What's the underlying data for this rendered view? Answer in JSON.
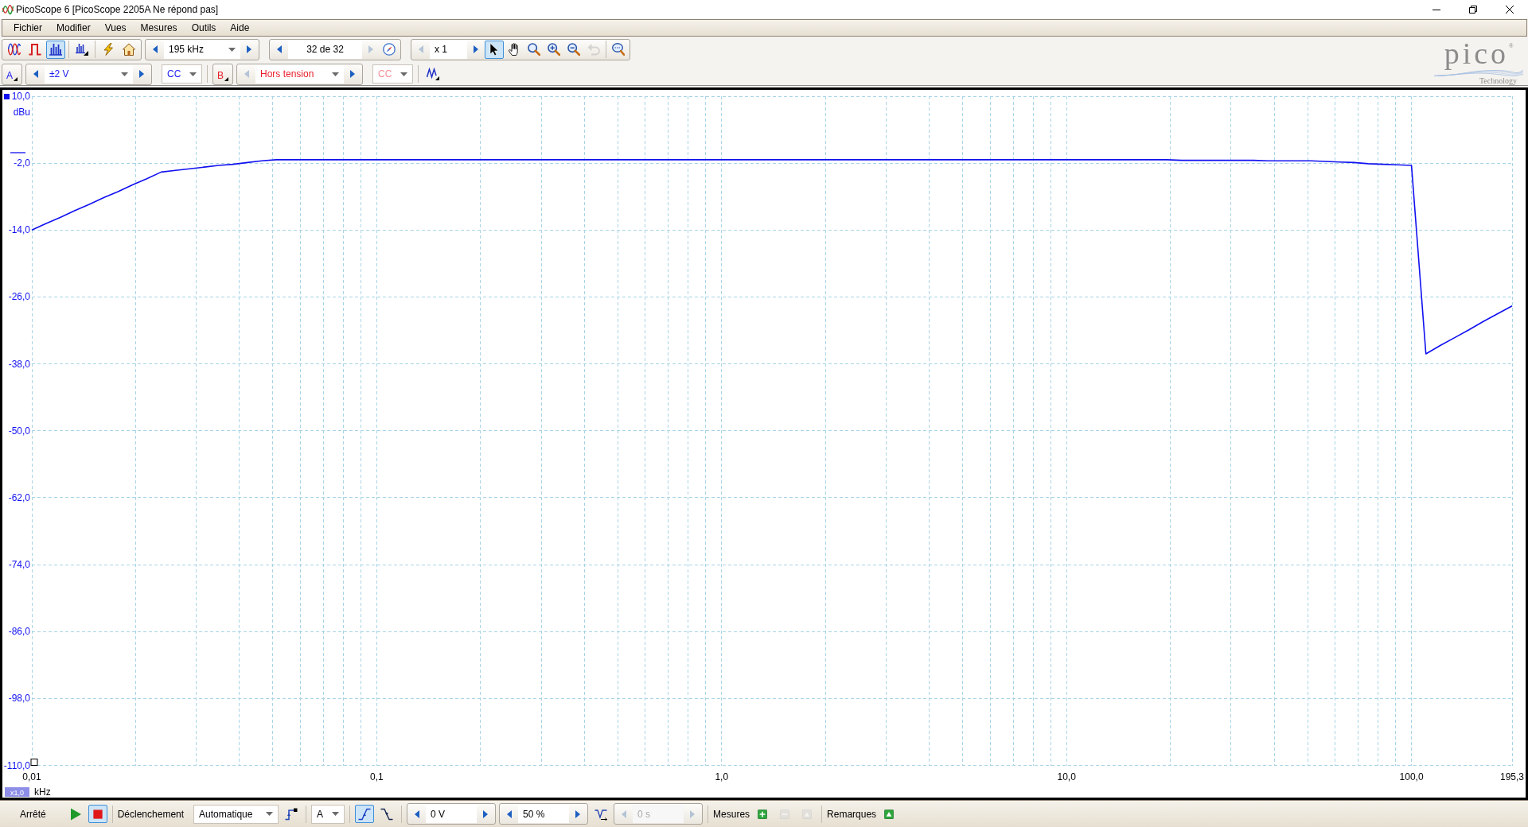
{
  "window": {
    "title": "PicoScope 6 [PicoScope 2205A Ne répond pas]"
  },
  "menu": [
    "Fichier",
    "Modifier",
    "Vues",
    "Mesures",
    "Outils",
    "Aide"
  ],
  "toolbar": {
    "modes": [
      {
        "kind": "scope",
        "selected": false
      },
      {
        "kind": "persistence",
        "selected": false
      },
      {
        "kind": "spectrum",
        "selected": true
      }
    ],
    "frequency_range": {
      "value": "195 kHz",
      "prev_disabled": false,
      "next_disabled": false
    },
    "buffer": {
      "value": "32 de 32",
      "prev_disabled": false,
      "next_disabled": true
    },
    "zoom_factor": {
      "value": "x 1",
      "prev_disabled": true,
      "next_disabled": false
    },
    "tools": [
      {
        "kind": "pointer",
        "selected": true,
        "disabled": false
      },
      {
        "kind": "hand",
        "selected": false,
        "disabled": false
      },
      {
        "kind": "zoom",
        "selected": false,
        "disabled": false
      },
      {
        "kind": "zoom_in",
        "selected": false,
        "disabled": false
      },
      {
        "kind": "zoom_out",
        "selected": false,
        "disabled": false
      },
      {
        "kind": "undo",
        "selected": false,
        "disabled": true
      }
    ]
  },
  "logo": {
    "name": "pico",
    "mark": "®",
    "tagline": "Technology"
  },
  "channels": [
    {
      "label": "A",
      "color": "#1c1cf0",
      "range": "±2 V",
      "prev_disabled": false,
      "next_disabled": false,
      "coupling": "CC",
      "coupling_disabled": false
    },
    {
      "label": "B",
      "color": "#e8202c",
      "range": "Hors tension",
      "prev_disabled": true,
      "next_disabled": false,
      "coupling": "CC",
      "coupling_disabled": true
    }
  ],
  "chart": {
    "x_zoom": "x1,0",
    "chart_data": {
      "type": "line",
      "grid": true,
      "xlabel": "kHz",
      "ylabel": "dBu",
      "categories": [
        "0,01",
        null,
        null,
        null,
        null,
        null,
        null,
        null,
        null,
        null,
        null,
        null,
        null,
        null,
        null,
        null,
        null,
        null,
        null,
        null,
        null,
        null,
        null,
        null,
        "0,1",
        null,
        null,
        null,
        null,
        null,
        null,
        null,
        null,
        null,
        null,
        null,
        null,
        null,
        null,
        null,
        null,
        null,
        null,
        null,
        null,
        null,
        null,
        null,
        "1,0",
        null,
        null,
        null,
        null,
        null,
        null,
        null,
        null,
        null,
        null,
        null,
        null,
        null,
        null,
        null,
        null,
        null,
        null,
        null,
        null,
        null,
        null,
        null,
        "10,0",
        null,
        null,
        null,
        null,
        null,
        null,
        null,
        null,
        null,
        null,
        null,
        null,
        null,
        null,
        null,
        null,
        null,
        null,
        null,
        null,
        null,
        null,
        null,
        "100,0",
        null,
        null,
        null,
        null,
        null,
        null,
        "195,3"
      ],
      "series": [
        {
          "color": "#1010f0",
          "values": [
            -14,
            -12.8,
            -11.7,
            -10.5,
            -9.4,
            -8.2,
            -7.1,
            -5.9,
            -4.8,
            -3.6,
            -3.3,
            -3,
            -2.7,
            -2.4,
            -2.2,
            -1.9,
            -1.6,
            -1.4,
            -1.4,
            -1.4,
            -1.4,
            -1.4,
            -1.4,
            -1.4,
            -1.4,
            -1.4,
            -1.4,
            -1.4,
            -1.4,
            -1.4,
            -1.4,
            -1.4,
            -1.4,
            -1.4,
            -1.4,
            -1.4,
            -1.4,
            -1.4,
            -1.4,
            -1.4,
            -1.4,
            -1.4,
            -1.4,
            -1.4,
            -1.4,
            -1.4,
            -1.4,
            -1.4,
            -1.4,
            -1.4,
            -1.4,
            -1.4,
            -1.4,
            -1.4,
            -1.4,
            -1.4,
            -1.4,
            -1.4,
            -1.4,
            -1.4,
            -1.4,
            -1.4,
            -1.4,
            -1.4,
            -1.4,
            -1.4,
            -1.4,
            -1.4,
            -1.4,
            -1.4,
            -1.4,
            -1.4,
            -1.4,
            -1.4,
            -1.4,
            -1.4,
            -1.4,
            -1.4,
            -1.4,
            -1.4,
            -1.5,
            -1.5,
            -1.5,
            -1.5,
            -1.5,
            -1.5,
            -1.6,
            -1.6,
            -1.6,
            -1.6,
            -1.7,
            -1.8,
            -1.9,
            -2.1,
            -2.2,
            -2.3,
            -2.4,
            -36.2,
            -34.7,
            -33.3,
            -31.9,
            -30.4,
            -29,
            -27.6
          ]
        }
      ],
      "ylim": [
        -110,
        10
      ],
      "yticks": [
        {
          "value": 10,
          "label": "10,0"
        },
        {
          "value": -2,
          "label": "-2,0"
        },
        {
          "value": -14,
          "label": "-14,0"
        },
        {
          "value": -26,
          "label": "-26,0"
        },
        {
          "value": -38,
          "label": "-38,0"
        },
        {
          "value": -50,
          "label": "-50,0"
        },
        {
          "value": -62,
          "label": "-62,0"
        },
        {
          "value": -74,
          "label": "-74,0"
        },
        {
          "value": -86,
          "label": "-86,0"
        },
        {
          "value": -98,
          "label": "-98,0"
        },
        {
          "value": -110,
          "label": "-110,0"
        }
      ]
    }
  },
  "status_bar": {
    "state": "Arrêté",
    "run_buttons": [
      {
        "kind": "play",
        "selected": false
      },
      {
        "kind": "stop",
        "selected": true
      }
    ],
    "trigger_label": "Déclenchement",
    "trigger_mode": "Automatique",
    "trigger_source": "A",
    "edges": [
      {
        "kind": "rising",
        "selected": true
      },
      {
        "kind": "falling",
        "selected": false
      }
    ],
    "threshold": {
      "value": "0 V",
      "disabled": false
    },
    "pre_trigger": {
      "value": "50 %",
      "disabled": false
    },
    "delay": {
      "value": "0 s",
      "disabled": true
    },
    "measurements_label": "Mesures",
    "measurement_buttons": [
      {
        "kind": "add",
        "disabled": false
      },
      {
        "kind": "remove",
        "disabled": true
      },
      {
        "kind": "edit",
        "disabled": true
      }
    ],
    "notes_label": "Remarques"
  }
}
